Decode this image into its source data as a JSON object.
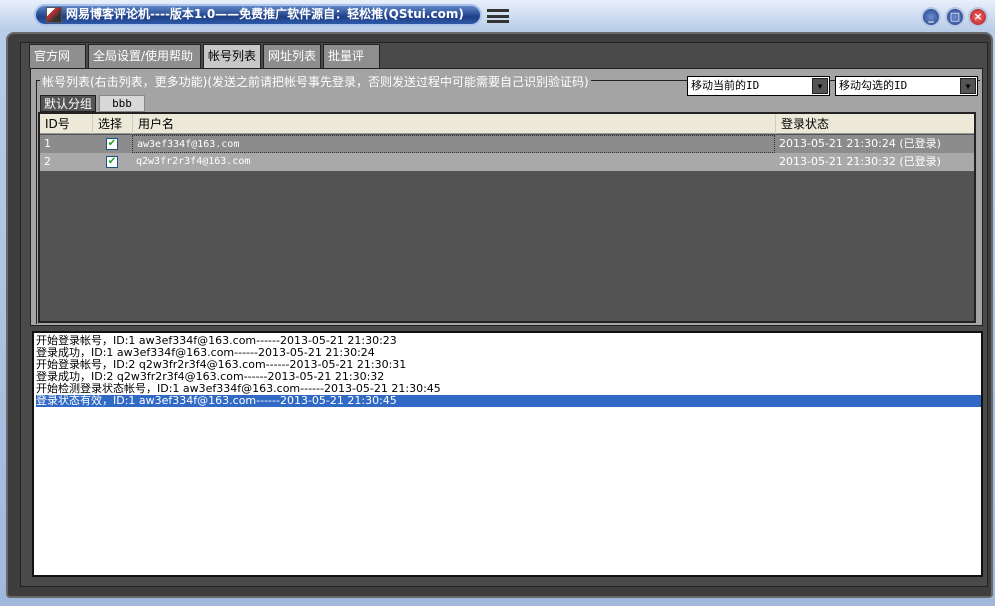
{
  "window": {
    "title": "网易博客评论机----版本1.0——免费推广软件源自：轻松推(QStui.com)",
    "minimize": "_",
    "maximize": "□",
    "close": "×"
  },
  "tabs": [
    {
      "label": "官方网站"
    },
    {
      "label": "全局设置/使用帮助"
    },
    {
      "label": "帐号列表",
      "active": true
    },
    {
      "label": "网址列表"
    },
    {
      "label": "批量评论"
    }
  ],
  "group": {
    "label": "帐号列表(右击列表，更多功能)(发送之前请把帐号事先登录，否则发送过程中可能需要自己识别验证码)",
    "combo_move_current": "移动当前的ID",
    "combo_move_checked": "移动勾选的ID",
    "group_tabs": [
      "默认分组",
      "bbb"
    ]
  },
  "table": {
    "columns": [
      "ID号",
      "选择",
      "用户名",
      "登录状态"
    ],
    "rows": [
      {
        "id": "1",
        "checked": true,
        "username": "aw3ef334f@163.com",
        "status": "2013-05-21 21:30:24 (已登录)"
      },
      {
        "id": "2",
        "checked": true,
        "username": "q2w3fr2r3f4@163.com",
        "status": "2013-05-21 21:30:32 (已登录)"
      }
    ]
  },
  "log": [
    "开始登录帐号，ID:1 aw3ef334f@163.com------2013-05-21 21:30:23",
    "登录成功，ID:1 aw3ef334f@163.com------2013-05-21 21:30:24",
    "开始登录帐号，ID:2 q2w3fr2r3f4@163.com------2013-05-21 21:30:31",
    "登录成功，ID:2 q2w3fr2r3f4@163.com------2013-05-21 21:30:32",
    "开始检测登录状态帐号，ID:1 aw3ef334f@163.com------2013-05-21 21:30:45",
    "登录状态有效，ID:1 aw3ef334f@163.com------2013-05-21 21:30:45"
  ]
}
